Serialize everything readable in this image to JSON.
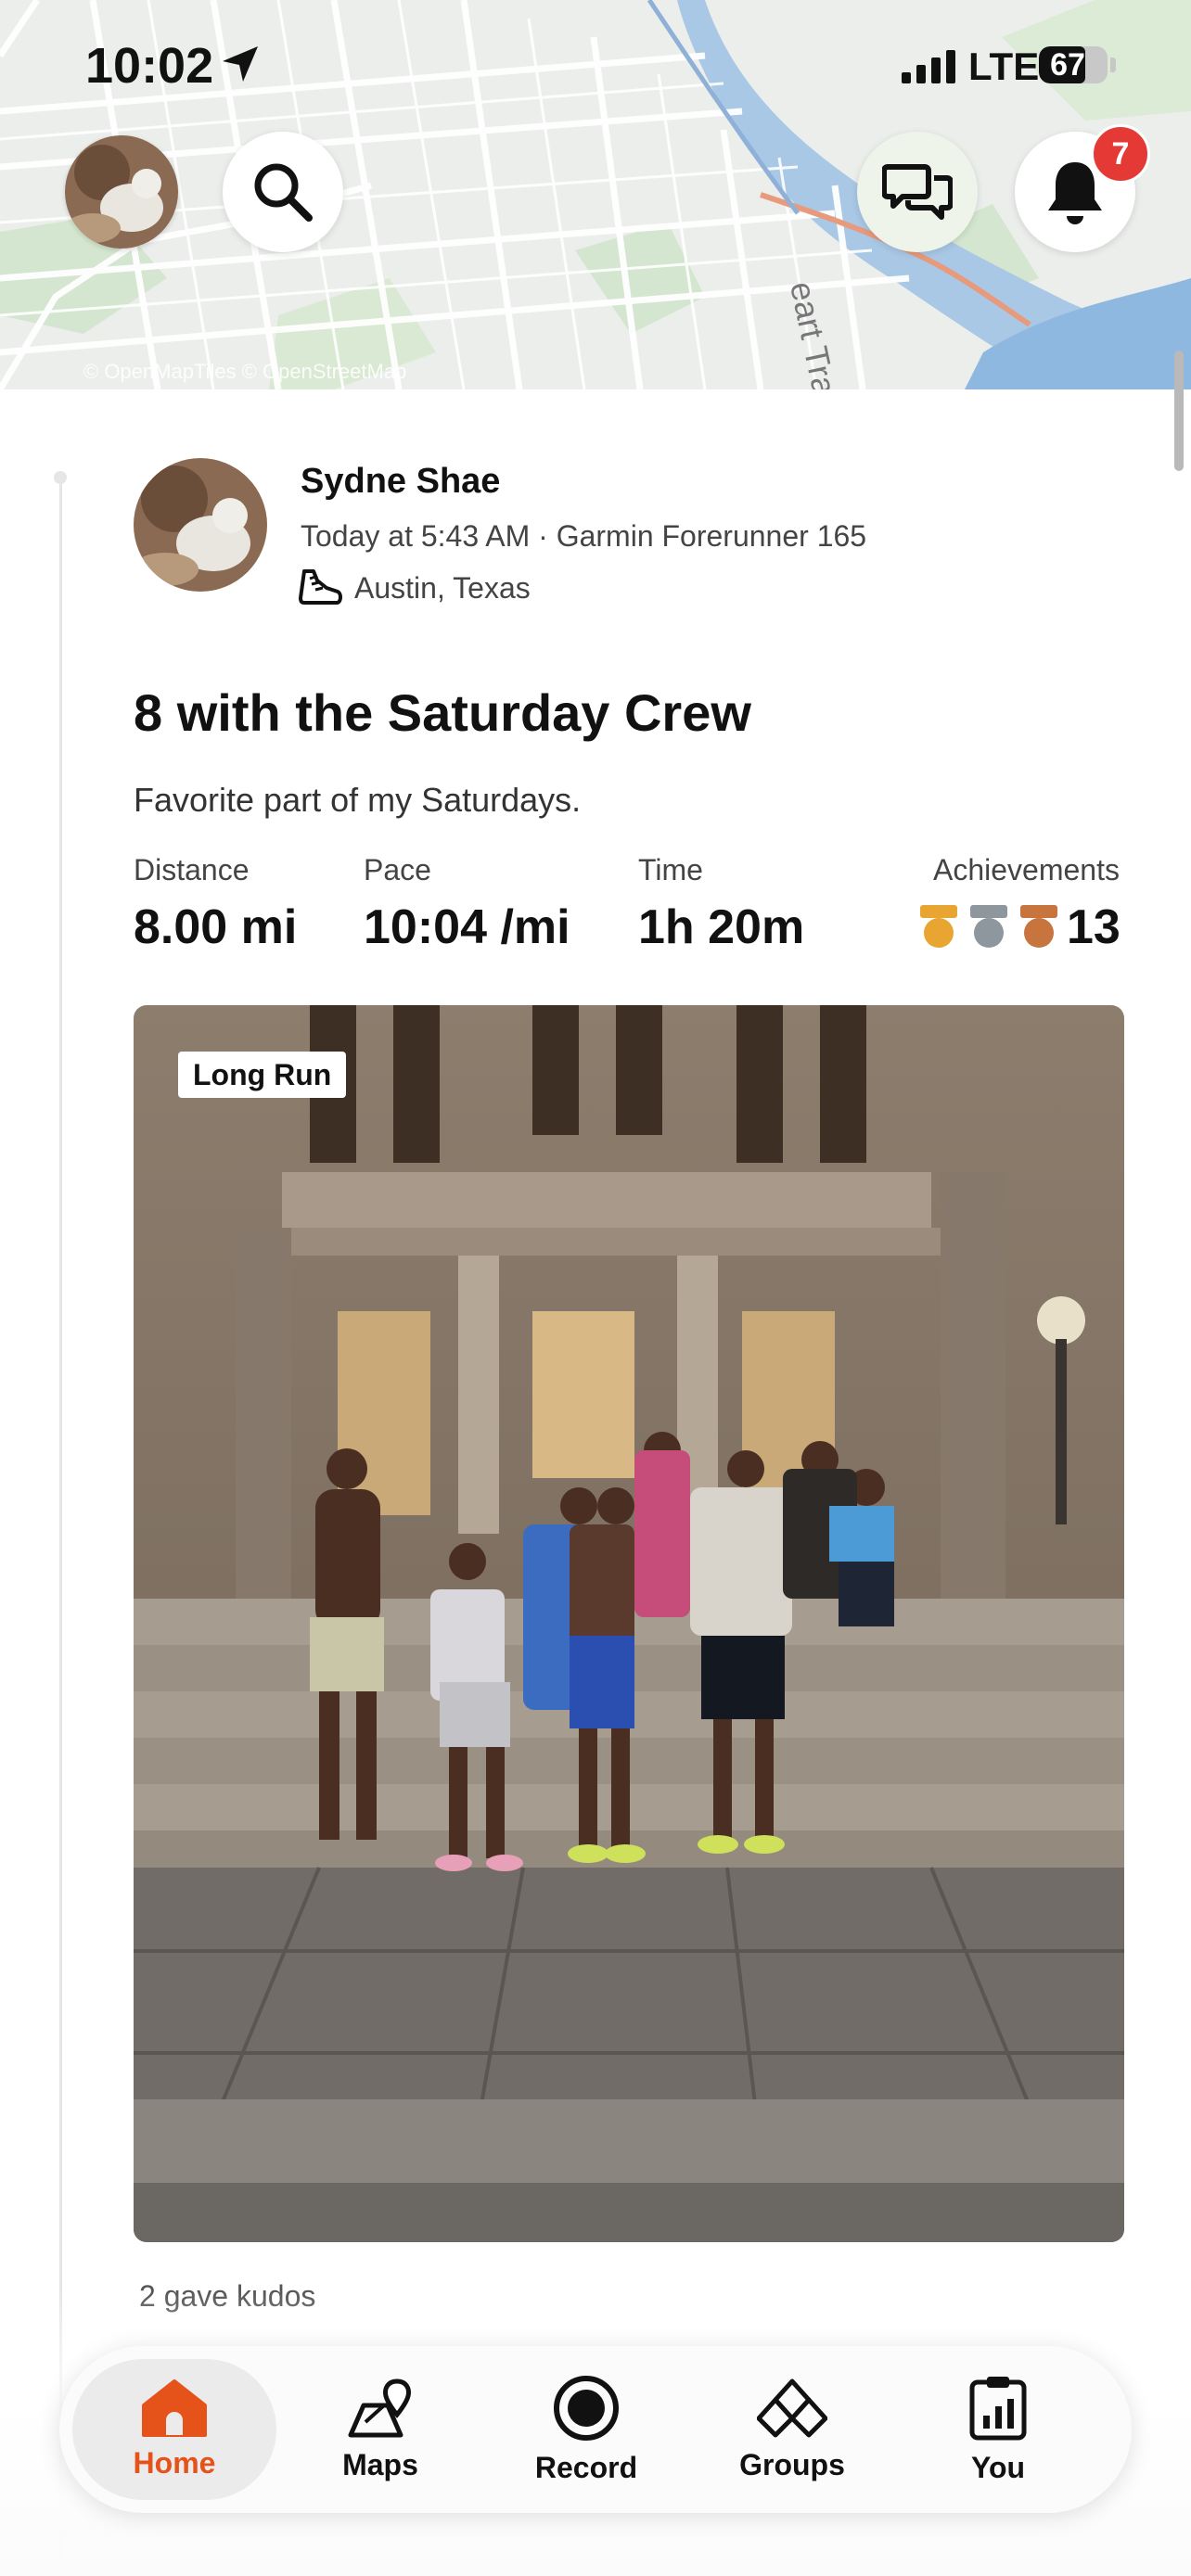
{
  "status_bar": {
    "time": "10:02",
    "network": "LTE",
    "battery": "67",
    "battery_level": 0.67
  },
  "map": {
    "trail_label": "eart Trai",
    "attribution": "© OpenMapTiles © OpenStreetMap"
  },
  "header": {
    "notification_count": "7",
    "icons": [
      "search-icon",
      "chat-icon",
      "bell-icon"
    ]
  },
  "post": {
    "athlete_name": "Sydne Shae",
    "meta": "Today at 5:43 AM · Garmin Forerunner 165",
    "location": "Austin, Texas",
    "title": "8 with the Saturday Crew",
    "description": "Favorite part of my Saturdays.",
    "stats": [
      {
        "label": "Distance",
        "value": "8.00 mi"
      },
      {
        "label": "Pace",
        "value": "10:04 /mi"
      },
      {
        "label": "Time",
        "value": "1h 20m"
      },
      {
        "label": "Achievements",
        "value": "13"
      }
    ],
    "medal_colors": [
      "#e8a531",
      "#8e979e",
      "#c7743f"
    ],
    "photo_tag": "Long Run",
    "kudos": "2 gave kudos"
  },
  "tabs": [
    {
      "label": "Home",
      "icon": "home-icon",
      "active": true
    },
    {
      "label": "Maps",
      "icon": "maps-icon",
      "active": false
    },
    {
      "label": "Record",
      "icon": "record-icon",
      "active": false
    },
    {
      "label": "Groups",
      "icon": "groups-icon",
      "active": false
    },
    {
      "label": "You",
      "icon": "you-icon",
      "active": false
    }
  ],
  "colors": {
    "accent": "#e5531a",
    "badge": "#e53935"
  }
}
